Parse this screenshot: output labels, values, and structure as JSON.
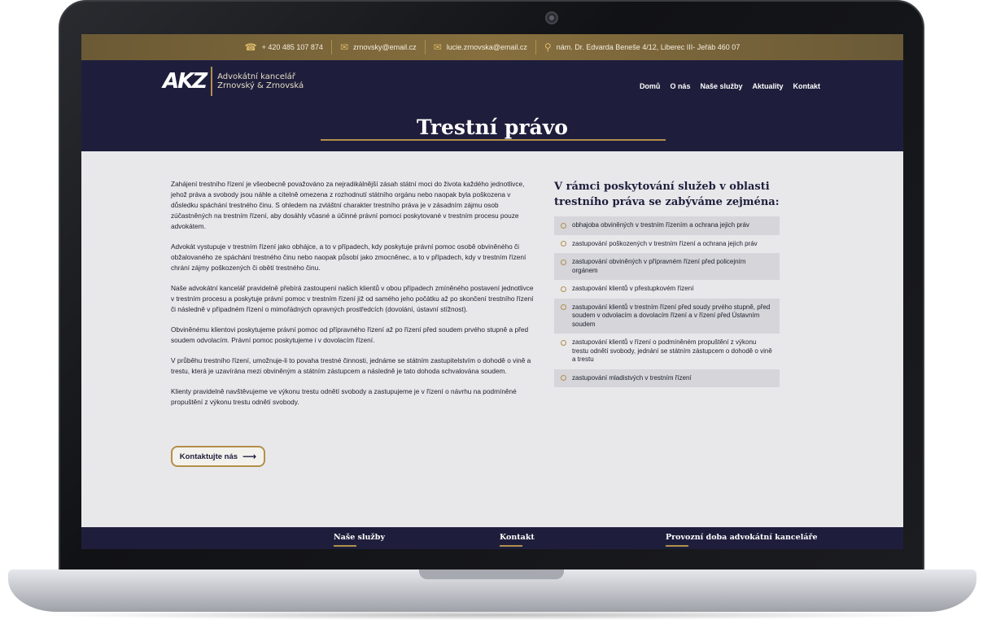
{
  "topbar": {
    "phone": "+ 420 485 107 874",
    "email1": "zrnovsky@email.cz",
    "email2": "lucie.zrnovska@email.cz",
    "address": "nám. Dr. Edvarda Beneše 4/12, Liberec III- Jeřáb 460 07",
    "icons": [
      "phone-icon",
      "mail-icon",
      "mail-icon",
      "location-pin-icon"
    ]
  },
  "logo": {
    "mark": "AKZ",
    "line1": "Advokátní kancelář",
    "line2": "Zrnovský & Zrnovská"
  },
  "nav": {
    "items": [
      "Domů",
      "O nás",
      "Naše služby",
      "Aktuality",
      "Kontakt"
    ]
  },
  "page": {
    "title": "Trestní právo"
  },
  "left": {
    "paragraphs": [
      "Zahájení trestního řízení je všeobecně považováno za nejradikálnější zásah státní moci do života každého jednotlivce, jehož práva a svobody jsou náhle a citelně omezena z rozhodnutí státního orgánu nebo naopak byla poškozena v důsledku spáchání trestného činu. S ohledem na zvláštní charakter trestního práva je v zásadním zájmu osob zúčastněných na trestním řízení, aby dosáhly včasné a účinné právní pomoci poskytované v trestním procesu pouze advokátem.",
      "Advokát vystupuje v trestním řízení jako obhájce, a to v případech, kdy poskytuje právní pomoc osobě obviněného či obžalovaného ze spáchání trestného činu nebo naopak působí jako zmocněnec, a to v případech, kdy v trestním řízení chrání zájmy poškozených či obětí trestného činu.",
      "Naše advokátní kancelář pravidelně přebírá zastoupení našich klientů v obou případech zmíněného postavení jednotlivce v trestním procesu a poskytuje právní pomoc v trestním řízení již od samého jeho počátku až po skončení trestního řízení či následně v případném řízení o mimořádných opravných prostředcích (dovolání, ústavní stížnost).",
      "Obviněnému klientovi poskytujeme právní pomoc od přípravného řízení až po řízení před soudem prvého stupně a před soudem odvolacím. Právní pomoc poskytujeme i v dovolacím řízení.",
      "V průběhu trestního řízení, umožnuje-li to povaha trestné činnosti, jednáme se státním zastupitelstvím o dohodě o vině a trestu, která je uzavírána mezi obviněným a státním zástupcem a následně je tato dohoda schvalována soudem.",
      "Klienty pravidelně navštěvujeme ve výkonu trestu odnětí svobody a zastupujeme je v řízení o návrhu na podmíněné propuštění z výkonu trestu odnětí svobody."
    ],
    "button_label": "Kontaktujte nás",
    "button_icon": "arrow-right-icon"
  },
  "right": {
    "title_line1": "V rámci poskytování služeb v oblasti",
    "title_line2": "trestního práva se zabýváme zejména:",
    "items": [
      "obhajoba obviněných v trestním řízením a ochrana jejich práv",
      "zastupování poškozených v trestním řízení a ochrana jejich práv",
      "zastupování obviněných v přípravném řízení před policejním orgánem",
      "zastupování klientů v přestupkovém řízení",
      "zastupování klientů v trestním řízení před soudy prvého stupně, před soudem v odvolacím a dovolacím řízení a v řízení před Ústavním soudem",
      "zastupování klientů v řízení o podmíněném propuštění z výkonu trestu odnětí svobody, jednání se státním zástupcem o dohodě o vině a trestu",
      "zastupování mladistvých v trestním řízení"
    ]
  },
  "footer": {
    "col1": "Naše služby",
    "col2": "Kontakt",
    "col3": "Provozní doba advokátní kanceláře"
  },
  "colors": {
    "navy": "#1e1e3c",
    "gold": "#b38f4a",
    "content_bg": "#e8e8eb"
  }
}
